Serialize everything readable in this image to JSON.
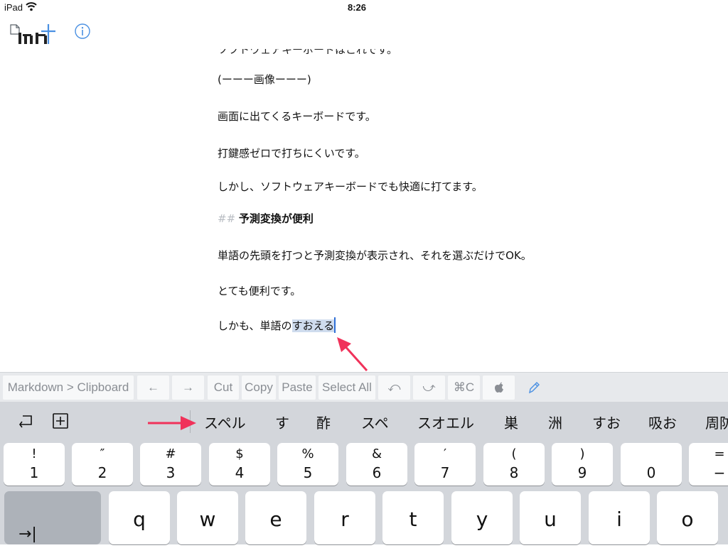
{
  "status": {
    "device": "iPad",
    "time": "8:26"
  },
  "editor": {
    "cut_line": "ソフトウェアキーボードはこれです。",
    "lines": [
      "(ーーー画像ーーー)",
      "画面に出てくるキーボードです。",
      "打鍵感ゼロで打ちにくいです。",
      "しかし、ソフトウェアキーボードでも快適に打てます。"
    ],
    "heading_mark": "##",
    "heading_text": "予測変換が便利",
    "lines2": [
      "単語の先頭を打つと予測変換が表示され、それを選ぶだけでOK。",
      "とても便利です。"
    ],
    "last_prefix": "しかも、単語の",
    "last_selected": "すおえる"
  },
  "shortcuts": [
    "Markdown > Clipboard",
    "←",
    "→",
    "Cut",
    "Copy",
    "Paste",
    "Select All",
    "⤺",
    "⤻",
    "⌘C",
    "",
    "✎"
  ],
  "candidates": [
    "スペル",
    "す",
    "酢",
    "スペ",
    "スオエル",
    "巣",
    "洲",
    "すお",
    "吸お",
    "周防"
  ],
  "number_keys": [
    {
      "top": "!",
      "bottom": "1"
    },
    {
      "top": "″",
      "bottom": "2"
    },
    {
      "top": "#",
      "bottom": "3"
    },
    {
      "top": "$",
      "bottom": "4"
    },
    {
      "top": "%",
      "bottom": "5"
    },
    {
      "top": "&",
      "bottom": "6"
    },
    {
      "top": "′",
      "bottom": "7"
    },
    {
      "top": "(",
      "bottom": "8"
    },
    {
      "top": ")",
      "bottom": "9"
    },
    {
      "top": "",
      "bottom": "0"
    },
    {
      "top": "=",
      "bottom": "−"
    }
  ],
  "letter_keys": [
    "q",
    "w",
    "e",
    "r",
    "t",
    "y",
    "u",
    "i",
    "o"
  ],
  "tab_key": "→|",
  "colors": {
    "selection": "#cfdcee",
    "caret": "#2f6fd6",
    "annotation_arrow": "#f0325a",
    "accent": "#4a90e2"
  }
}
